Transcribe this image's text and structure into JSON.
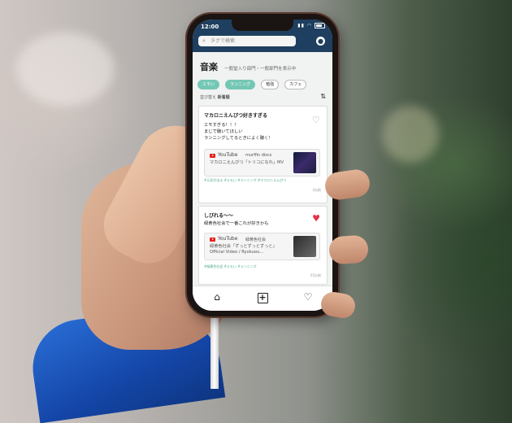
{
  "status_bar": {
    "time": "12:00"
  },
  "search": {
    "placeholder": "タグで検索"
  },
  "header": {
    "title": "音楽",
    "subtitle": "一般堂入り部門・一般部門を表示中"
  },
  "chips": [
    {
      "label": "エモい",
      "active": true
    },
    {
      "label": "ランニング",
      "active": true
    },
    {
      "label": "勉強",
      "active": false
    },
    {
      "label": "カフェ",
      "active": false
    }
  ],
  "sort": {
    "label": "並び替え",
    "value": "新着順"
  },
  "posts": [
    {
      "title": "マカロニえんぴつ好きすぎる",
      "body": "エモすぎる！！！\nまじで聴いてほしい\nランニングしてるときによく聴く！",
      "liked": false,
      "embed": {
        "service": "YouTube",
        "channel": "murffin discs",
        "video_title": "マカロニえんぴつ「トリコになれ」MV"
      },
      "tags": "#元気が出る  #エモい  #ランニング  #マカロニえんぴつ",
      "time_ago": "3分前"
    },
    {
      "title": "しびれる〜〜",
      "body": "緑黄色社会で一番これが好きかも",
      "liked": true,
      "embed": {
        "service": "YouTube",
        "channel": "緑黄色社会",
        "video_title": "緑黄色社会「ずっとずっとずっと」Official Video / Ryokuou..."
      },
      "tags": "#緑黄色社会  #エモい  #ランニング",
      "time_ago": "55分前"
    }
  ],
  "colors": {
    "header_bg": "#1e3f5f",
    "chip_active": "#74c7b5",
    "heart_liked": "#e2334a",
    "tag_text": "#4aa98f"
  },
  "icons": [
    "search-icon",
    "user-icon",
    "sort-icon",
    "heart-icon",
    "youtube-icon",
    "home-icon",
    "add-icon",
    "favorites-icon"
  ]
}
